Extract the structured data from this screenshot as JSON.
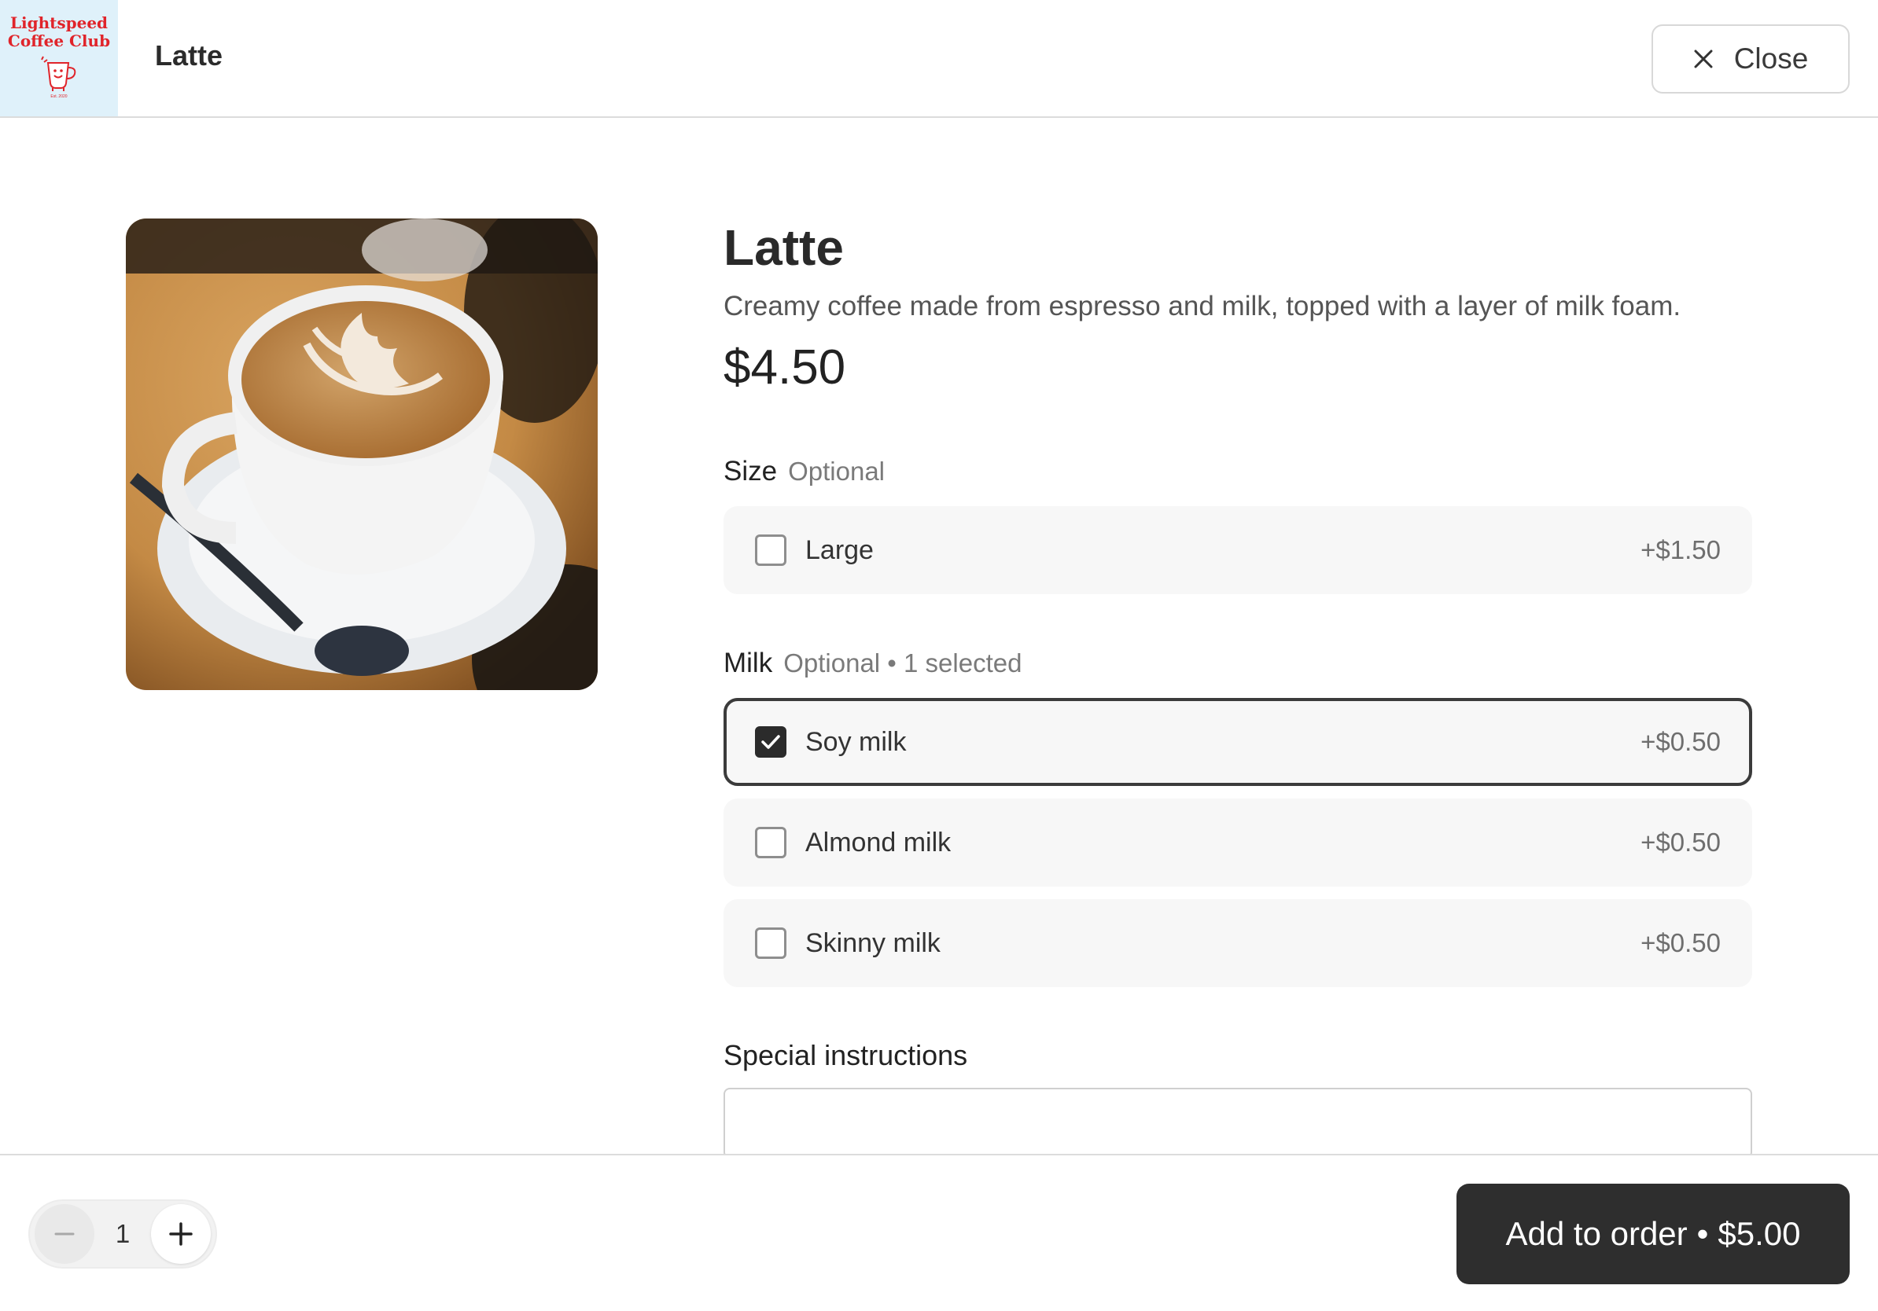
{
  "header": {
    "logo_line1": "Lightspeed",
    "logo_line2": "Coffee Club",
    "logo_small": "Est. 2020",
    "title": "Latte",
    "close_label": "Close"
  },
  "product": {
    "image": "latte-art-cup-photo",
    "name": "Latte",
    "description": "Creamy coffee made from espresso and milk, topped with a layer of milk foam.",
    "price": "$4.50"
  },
  "size_group": {
    "label": "Size",
    "note": "Optional",
    "options": [
      {
        "label": "Large",
        "price": "+$1.50",
        "checked": false
      }
    ]
  },
  "milk_group": {
    "label": "Milk",
    "note": "Optional • 1 selected",
    "options": [
      {
        "label": "Soy milk",
        "price": "+$0.50",
        "checked": true
      },
      {
        "label": "Almond milk",
        "price": "+$0.50",
        "checked": false
      },
      {
        "label": "Skinny milk",
        "price": "+$0.50",
        "checked": false
      }
    ]
  },
  "instructions": {
    "label": "Special instructions",
    "value": ""
  },
  "footer": {
    "quantity": "1",
    "add_label": "Add to order",
    "separator": "•",
    "total": "$5.00"
  },
  "colors": {
    "accent_dark": "#2e2e2e",
    "logo_bg": "#dff1fa",
    "logo_red": "#e0242a",
    "option_bg": "#f7f7f7"
  }
}
